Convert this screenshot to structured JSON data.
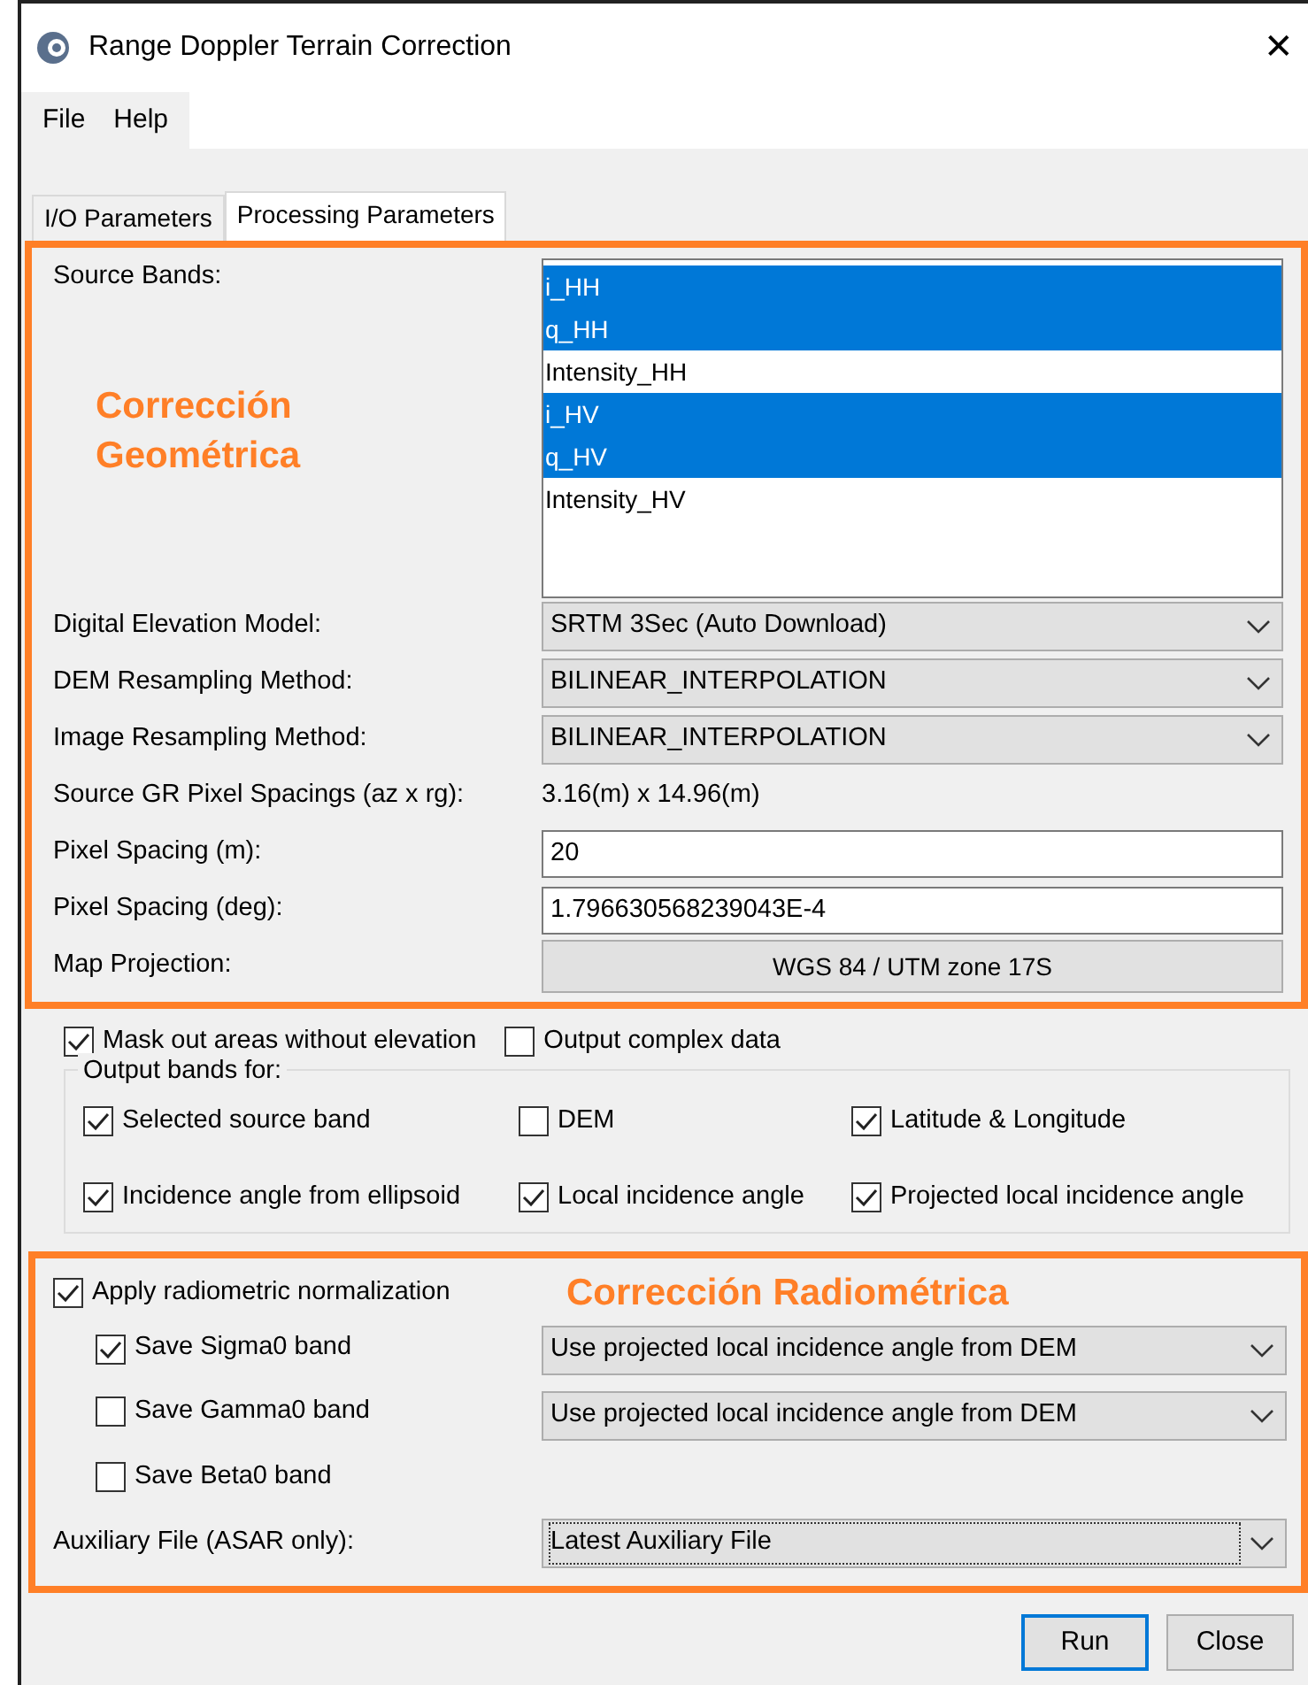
{
  "window": {
    "title": "Range Doppler Terrain Correction",
    "close": "✕"
  },
  "menu": [
    "File",
    "Help"
  ],
  "tabs": [
    {
      "label": "I/O Parameters",
      "selected": false
    },
    {
      "label": "Processing Parameters",
      "selected": true
    }
  ],
  "geometric_section": {
    "annotation": "Corrección Geométrica",
    "source_bands": {
      "label": "Source Bands:",
      "items": [
        {
          "text": "i_HH",
          "selected": true
        },
        {
          "text": "q_HH",
          "selected": true
        },
        {
          "text": "Intensity_HH",
          "selected": false
        },
        {
          "text": "i_HV",
          "selected": true
        },
        {
          "text": "q_HV",
          "selected": true
        },
        {
          "text": "Intensity_HV",
          "selected": false
        }
      ]
    },
    "fields": [
      {
        "kind": "select",
        "label": "Digital Elevation Model:",
        "value": "SRTM 3Sec (Auto Download)"
      },
      {
        "kind": "select",
        "label": "DEM Resampling Method:",
        "value": "BILINEAR_INTERPOLATION"
      },
      {
        "kind": "select",
        "label": "Image Resampling Method:",
        "value": "BILINEAR_INTERPOLATION"
      },
      {
        "kind": "text",
        "label": "Source GR Pixel Spacings (az x rg):",
        "value": "3.16(m) x 14.96(m)"
      },
      {
        "kind": "input",
        "label": "Pixel Spacing (m):",
        "value": "20"
      },
      {
        "kind": "input",
        "label": "Pixel Spacing (deg):",
        "value": "1.796630568239043E-4"
      },
      {
        "kind": "button",
        "label": "Map Projection:",
        "value": "WGS 84 / UTM zone 17S"
      }
    ]
  },
  "options": [
    {
      "label": "Mask out areas without elevation",
      "checked": true
    },
    {
      "label": "Output complex data",
      "checked": false
    }
  ],
  "output_bands": {
    "title": "Output bands for:",
    "items": [
      {
        "label": "Selected source band",
        "checked": true
      },
      {
        "label": "DEM",
        "checked": false
      },
      {
        "label": "Latitude & Longitude",
        "checked": true
      },
      {
        "label": "Incidence angle from ellipsoid",
        "checked": true
      },
      {
        "label": "Local incidence angle",
        "checked": true
      },
      {
        "label": "Projected local incidence angle",
        "checked": true
      }
    ]
  },
  "radiometric_section": {
    "annotation": "Corrección Radiométrica",
    "apply": {
      "label": "Apply radiometric normalization",
      "checked": true
    },
    "bands": [
      {
        "label": "Save Sigma0 band",
        "checked": true,
        "select": "Use projected local incidence angle from DEM"
      },
      {
        "label": "Save Gamma0 band",
        "checked": false,
        "select": "Use projected local incidence angle from DEM"
      },
      {
        "label": "Save Beta0 band",
        "checked": false
      }
    ],
    "auxiliary": {
      "label": "Auxiliary File (ASAR only):",
      "value": "Latest Auxiliary File"
    }
  },
  "buttons": [
    {
      "label": "Run",
      "focused": true
    },
    {
      "label": "Close",
      "focused": false
    }
  ]
}
